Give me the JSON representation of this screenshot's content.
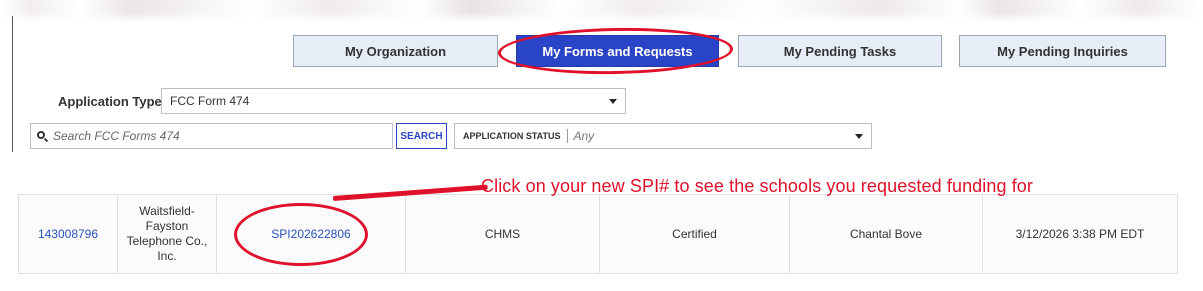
{
  "tabs": [
    {
      "label": "My Organization",
      "active": false
    },
    {
      "label": "My Forms and Requests",
      "active": true
    },
    {
      "label": "My Pending Tasks",
      "active": false
    },
    {
      "label": "My Pending Inquiries",
      "active": false
    }
  ],
  "filters": {
    "application_type_label": "Application Type",
    "application_type_value": "FCC Form 474",
    "search_placeholder": "Search FCC Forms 474",
    "search_button": "SEARCH",
    "status_label": "APPLICATION STATUS",
    "status_value": "Any"
  },
  "annotation": {
    "text": "Click on your new SPI# to see the schools you requested funding for",
    "color": "#e0112a"
  },
  "results": [
    {
      "id": "143008796",
      "provider": "Waitsfield-Fayston Telephone Co., Inc.",
      "spi": "SPI202622806",
      "nickname": "CHMS",
      "status": "Certified",
      "user": "Chantal Bove",
      "date": "3/12/2026 3:38 PM EDT"
    }
  ],
  "colors": {
    "accent": "#2a44c7",
    "tab_inactive": "#e6edf7",
    "link": "#2a52be",
    "highlight": "#e0112a"
  },
  "icons": [
    "search-icon",
    "chevron-down-icon"
  ]
}
